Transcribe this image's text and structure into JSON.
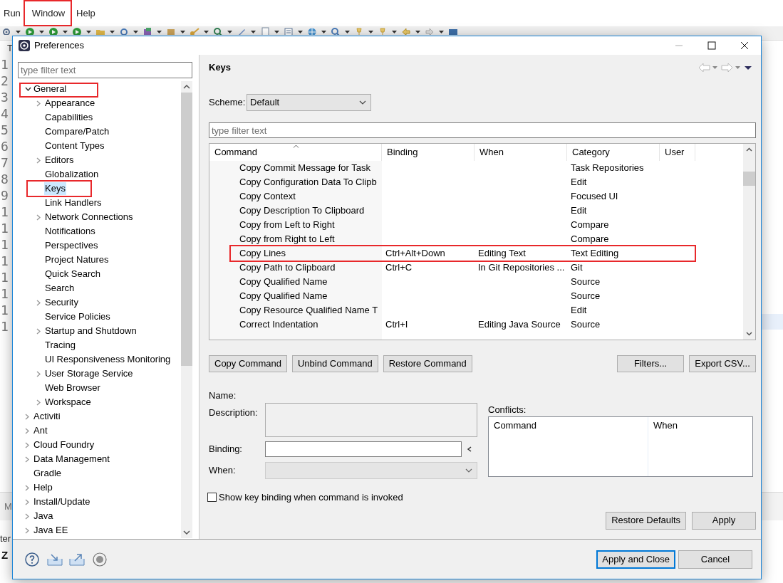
{
  "background": {
    "menu": [
      {
        "label": "Run"
      },
      {
        "label": "Window",
        "annotated": true
      },
      {
        "label": "Help"
      }
    ],
    "editor_tab": "T",
    "gutter_lines": [
      "1",
      "2",
      "3",
      "4",
      "5",
      "6",
      "7",
      "8",
      "9",
      "1",
      "1",
      "1",
      "1",
      "1",
      "1",
      "1",
      "1"
    ],
    "panel_tab": "M",
    "console_text": "ter",
    "bottom_text": "Z"
  },
  "window": {
    "title": "Preferences"
  },
  "filter": {
    "placeholder": "type filter text"
  },
  "tree": [
    {
      "label": "General",
      "expanded": true,
      "annotated": true,
      "selected": false,
      "children": [
        {
          "label": "Appearance",
          "expanded": false,
          "selected": false
        },
        {
          "label": "Capabilities",
          "selected": false
        },
        {
          "label": "Compare/Patch",
          "selected": false
        },
        {
          "label": "Content Types",
          "selected": false
        },
        {
          "label": "Editors",
          "expanded": false,
          "selected": false
        },
        {
          "label": "Globalization",
          "selected": false
        },
        {
          "label": "Keys",
          "selected": true,
          "annotated": true
        },
        {
          "label": "Link Handlers",
          "selected": false
        },
        {
          "label": "Network Connections",
          "expanded": false,
          "selected": false
        },
        {
          "label": "Notifications",
          "selected": false
        },
        {
          "label": "Perspectives",
          "selected": false
        },
        {
          "label": "Project Natures",
          "selected": false
        },
        {
          "label": "Quick Search",
          "selected": false
        },
        {
          "label": "Search",
          "selected": false
        },
        {
          "label": "Security",
          "expanded": false,
          "selected": false
        },
        {
          "label": "Service Policies",
          "selected": false
        },
        {
          "label": "Startup and Shutdown",
          "expanded": false,
          "selected": false
        },
        {
          "label": "Tracing",
          "selected": false
        },
        {
          "label": "UI Responsiveness Monitoring",
          "selected": false
        },
        {
          "label": "User Storage Service",
          "expanded": false,
          "selected": false
        },
        {
          "label": "Web Browser",
          "selected": false
        },
        {
          "label": "Workspace",
          "expanded": false,
          "selected": false
        }
      ]
    },
    {
      "label": "Activiti",
      "expanded": false,
      "selected": false
    },
    {
      "label": "Ant",
      "expanded": false,
      "selected": false
    },
    {
      "label": "Cloud Foundry",
      "expanded": false,
      "selected": false
    },
    {
      "label": "Data Management",
      "expanded": false,
      "selected": false
    },
    {
      "label": "Gradle",
      "selected": false
    },
    {
      "label": "Help",
      "expanded": false,
      "selected": false
    },
    {
      "label": "Install/Update",
      "expanded": false,
      "selected": false
    },
    {
      "label": "Java",
      "expanded": false,
      "selected": false
    },
    {
      "label": "Java EE",
      "expanded": false,
      "selected": false
    }
  ],
  "page": {
    "title": "Keys",
    "scheme": {
      "label": "Scheme:",
      "value": "Default"
    },
    "filter": {
      "placeholder": "type filter text"
    },
    "table": {
      "columns": [
        {
          "label": "Command",
          "sorted": true
        },
        {
          "label": "Binding",
          "sorted": false
        },
        {
          "label": "When",
          "sorted": false
        },
        {
          "label": "Category",
          "sorted": false
        },
        {
          "label": "User",
          "sorted": false
        }
      ],
      "rows": [
        {
          "command": "Copy Commit Message for Task",
          "category": "Task Repositories"
        },
        {
          "command": "Copy Configuration Data To Clipb",
          "category": "Edit"
        },
        {
          "command": "Copy Context",
          "category": "Focused UI"
        },
        {
          "command": "Copy Description To Clipboard",
          "category": "Edit"
        },
        {
          "command": "Copy from Left to Right",
          "category": "Compare"
        },
        {
          "command": "Copy from Right to Left",
          "category": "Compare"
        },
        {
          "command": "Copy Lines",
          "binding": "Ctrl+Alt+Down",
          "when": "Editing Text",
          "category": "Text Editing",
          "annotated": true
        },
        {
          "command": "Copy Path to Clipboard",
          "binding": "Ctrl+C",
          "when": "In Git Repositories ...",
          "category": "Git"
        },
        {
          "command": "Copy Qualified Name",
          "category": "Source"
        },
        {
          "command": "Copy Qualified Name",
          "category": "Source"
        },
        {
          "command": "Copy Resource Qualified Name T",
          "category": "Edit"
        },
        {
          "command": "Correct Indentation",
          "binding": "Ctrl+I",
          "when": "Editing Java Source",
          "category": "Source"
        }
      ]
    },
    "table_buttons": [
      "Copy Command",
      "Unbind Command",
      "Restore Command"
    ],
    "table_buttons_right": [
      "Filters...",
      "Export CSV..."
    ],
    "details": {
      "name_label": "Name:",
      "description_label": "Description:",
      "binding_label": "Binding:",
      "when_label": "When:",
      "conflicts_label": "Conflicts:",
      "conflict_columns": [
        "Command",
        "When"
      ]
    },
    "show_binding": {
      "label": "Show key binding when command is invoked",
      "checked": false
    },
    "buttons": [
      "Restore Defaults",
      "Apply"
    ]
  },
  "footer_buttons": [
    {
      "label": "Apply and Close",
      "default": true
    },
    {
      "label": "Cancel",
      "default": false
    }
  ]
}
